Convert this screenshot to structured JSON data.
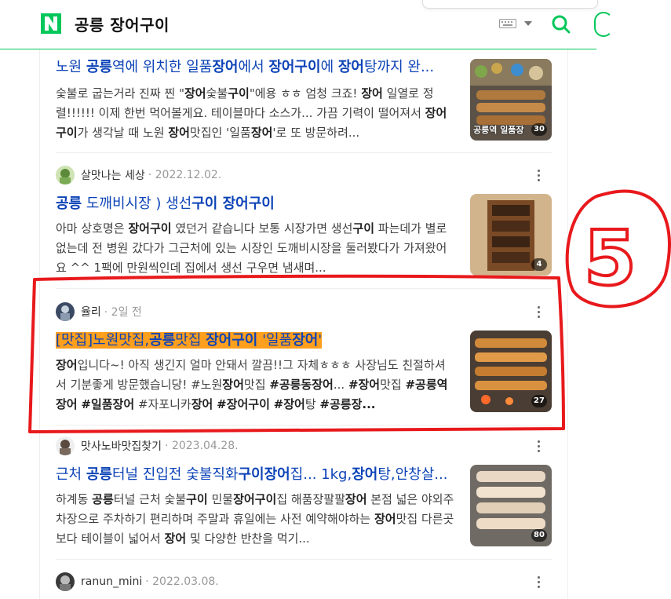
{
  "header": {
    "query": "공릉 장어구이",
    "colors": {
      "brand": "#03c75a"
    }
  },
  "results": [
    {
      "author": "",
      "date": "",
      "title_parts": [
        {
          "t": "노원 ",
          "b": false
        },
        {
          "t": "공릉",
          "b": true
        },
        {
          "t": "역에 위치한 일품",
          "b": false
        },
        {
          "t": "장어",
          "b": true
        },
        {
          "t": "에서 ",
          "b": false
        },
        {
          "t": "장어구이",
          "b": true
        },
        {
          "t": "에 ",
          "b": false
        },
        {
          "t": "장어",
          "b": true
        },
        {
          "t": "탕까지 완...",
          "b": false
        }
      ],
      "desc_parts": [
        {
          "t": "숯불로 굽는거라 진짜 찐 \"",
          "b": false
        },
        {
          "t": "장어",
          "b": true
        },
        {
          "t": "숯불",
          "b": false
        },
        {
          "t": "구이",
          "b": true
        },
        {
          "t": "\"에용 ㅎㅎ 엄청 크죠! ",
          "b": false
        },
        {
          "t": "장어",
          "b": true
        },
        {
          "t": " 일열로 정렬!!!!!! 이제 한번 먹어볼게요. 테이블마다 소스가... 가끔 기력이 떨어져서 ",
          "b": false
        },
        {
          "t": "장어구이",
          "b": true
        },
        {
          "t": "가 생각날 때 노원 ",
          "b": false
        },
        {
          "t": "장어",
          "b": true
        },
        {
          "t": "맛집인 '일품",
          "b": false
        },
        {
          "t": "장어",
          "b": true
        },
        {
          "t": "'로 또 방문하려...",
          "b": false
        }
      ],
      "thumb_caption": "공릉역 일품장",
      "thumb_count": "30"
    },
    {
      "author": "살맛나는 세상",
      "date": "· 2022.12.02.",
      "title_parts": [
        {
          "t": "공릉",
          "b": true
        },
        {
          "t": " 도깨비시장 ) 생선",
          "b": false
        },
        {
          "t": "구이 장어구이",
          "b": true
        }
      ],
      "desc_parts": [
        {
          "t": "아마 상호명은 ",
          "b": false
        },
        {
          "t": "장어구이",
          "b": true
        },
        {
          "t": " 였던거 같습니다 보통 시장가면 생선",
          "b": false
        },
        {
          "t": "구이",
          "b": true
        },
        {
          "t": " 파는데가 별로 없는데 전 병원 갔다가 그근처에 있는 시장인 도깨비시장을 둘러봤다가 가져왔어요 ^^ 1팩에 만원씩인데 집에서 생선 구우면 냄새며...",
          "b": false
        }
      ],
      "thumb_caption": "",
      "thumb_count": "4"
    },
    {
      "author": "율리",
      "date": "· 2일 전",
      "title_parts": [
        {
          "t": "[맛집]노원맛집,",
          "b": false,
          "hl": true
        },
        {
          "t": "공릉",
          "b": true,
          "hl": true
        },
        {
          "t": "맛집 ",
          "b": false,
          "hl": true
        },
        {
          "t": "장어구이",
          "b": true,
          "hl": true
        },
        {
          "t": " '일품",
          "b": false,
          "hl": true
        },
        {
          "t": "장어",
          "b": true,
          "hl": true
        },
        {
          "t": "'",
          "b": false,
          "hl": true
        }
      ],
      "desc_parts": [
        {
          "t": "장어",
          "b": true
        },
        {
          "t": "입니다~! 아직 생긴지 얼마 안돼서 깔끔!!그 자체ㅎㅎㅎ 사장님도 친절하셔서 기분좋게 방문했습니당! #노원",
          "b": false
        },
        {
          "t": "장어",
          "b": true
        },
        {
          "t": "맛집 ",
          "b": false
        },
        {
          "t": "#공릉동장어",
          "b": true
        },
        {
          "t": "... ",
          "b": false
        },
        {
          "t": "#장어",
          "b": true
        },
        {
          "t": "맛집 ",
          "b": false
        },
        {
          "t": "#공릉역장어",
          "b": true
        },
        {
          "t": " ",
          "b": false
        },
        {
          "t": "#일품장어",
          "b": true
        },
        {
          "t": " #자포니카",
          "b": false
        },
        {
          "t": "장어",
          "b": true
        },
        {
          "t": " ",
          "b": false
        },
        {
          "t": "#장어구이",
          "b": true
        },
        {
          "t": " ",
          "b": false
        },
        {
          "t": "#장어",
          "b": true
        },
        {
          "t": "탕 ",
          "b": false
        },
        {
          "t": "#공릉장...",
          "b": true
        }
      ],
      "thumb_caption": "",
      "thumb_count": "27"
    },
    {
      "author": "맛사노바맛집찾기",
      "date": "· 2023.04.28.",
      "title_parts": [
        {
          "t": "근처 ",
          "b": false
        },
        {
          "t": "공릉",
          "b": true
        },
        {
          "t": "터널 진입전 숯불직화",
          "b": false
        },
        {
          "t": "구이장어",
          "b": true
        },
        {
          "t": "집... 1kg,",
          "b": false
        },
        {
          "t": "장어",
          "b": true
        },
        {
          "t": "탕,안창살...",
          "b": false
        }
      ],
      "desc_parts": [
        {
          "t": "하계동 ",
          "b": false
        },
        {
          "t": "공릉",
          "b": true
        },
        {
          "t": "터널 근처 숯불",
          "b": false
        },
        {
          "t": "구이",
          "b": true
        },
        {
          "t": " 민물",
          "b": false
        },
        {
          "t": "장어구이",
          "b": true
        },
        {
          "t": "집 해품장팔팔",
          "b": false
        },
        {
          "t": "장어",
          "b": true
        },
        {
          "t": " 본점 넓은 야외주차장으로 주차하기 편리하며 주말과 휴일에는 사전 예약해야하는 ",
          "b": false
        },
        {
          "t": "장어",
          "b": true
        },
        {
          "t": "맛집 다른곳보다 테이블이 넓어서 ",
          "b": false
        },
        {
          "t": "장어",
          "b": true
        },
        {
          "t": " 및 다양한 반찬을 먹기...",
          "b": false
        }
      ],
      "thumb_caption": "",
      "thumb_count": "80"
    },
    {
      "author": "ranun_mini",
      "date": "· 2022.03.08.",
      "title_parts": [],
      "desc_parts": [],
      "thumb_caption": "",
      "thumb_count": ""
    }
  ],
  "annotation": {
    "label": "5",
    "color": "#e8191c"
  }
}
